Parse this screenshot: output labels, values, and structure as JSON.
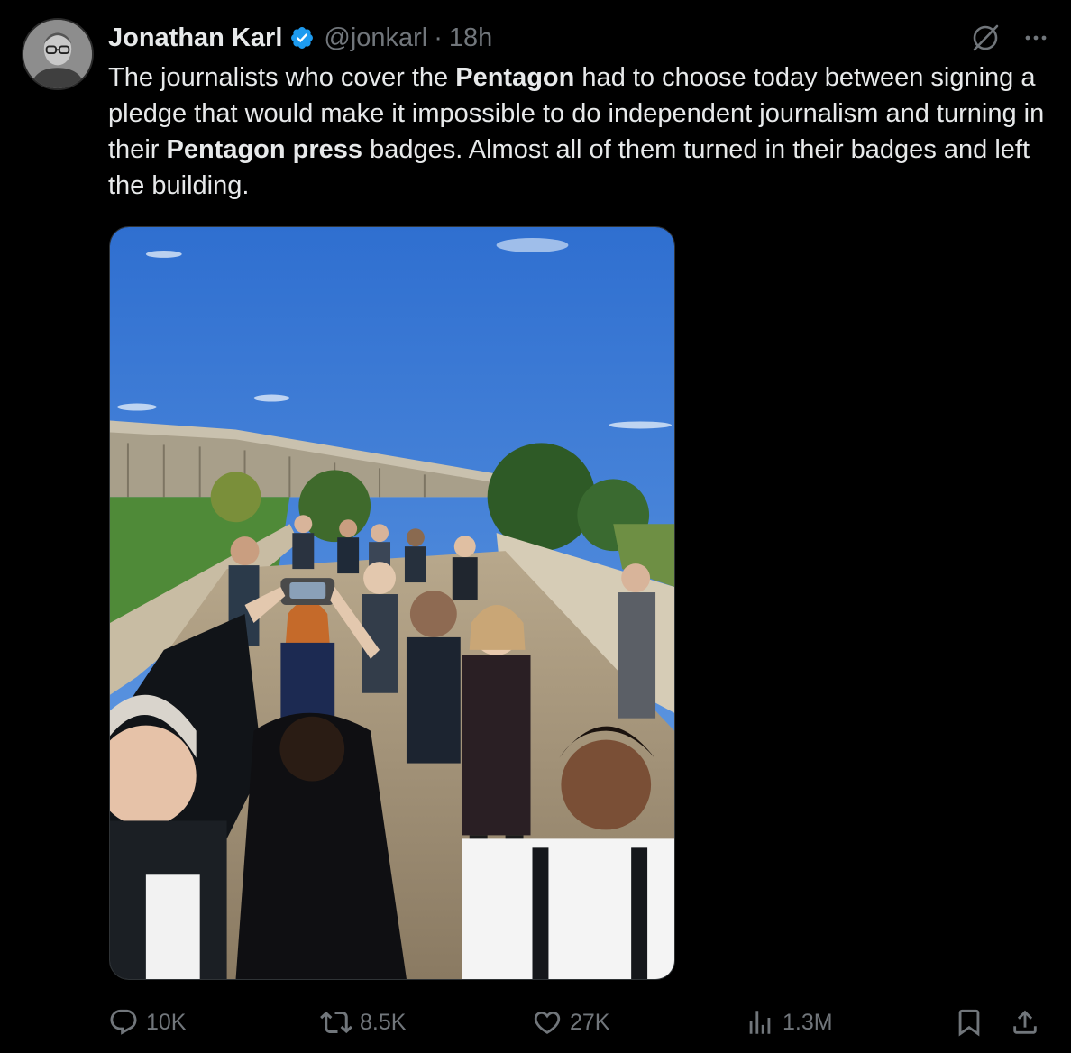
{
  "author": {
    "name": "Jonathan Karl",
    "handle": "@jonkarl",
    "separator": "·",
    "time": "18h",
    "avatar_icon": "avatar-photo",
    "verified_color": "#1d9bf0"
  },
  "tweet": {
    "text_segments": [
      {
        "text": "The journalists who cover the ",
        "bold": false
      },
      {
        "text": "Pentagon",
        "bold": true
      },
      {
        "text": " had to choose today between signing a pledge that would make it impossible to do independent journalism and turning in their ",
        "bold": false
      },
      {
        "text": "Pentagon press",
        "bold": true
      },
      {
        "text": " badges. Almost all of them turned in their badges and left the building.",
        "bold": false
      }
    ]
  },
  "media": {
    "type": "photo",
    "icon": "photo-pentagon-journalists"
  },
  "top_icons": [
    "grok-icon",
    "more-icon"
  ],
  "actions": {
    "replies": "10K",
    "reposts": "8.5K",
    "likes": "27K",
    "views": "1.3M"
  },
  "colors": {
    "background": "#000000",
    "text": "#e7e9ea",
    "muted": "#71767b",
    "accent": "#1d9bf0"
  }
}
